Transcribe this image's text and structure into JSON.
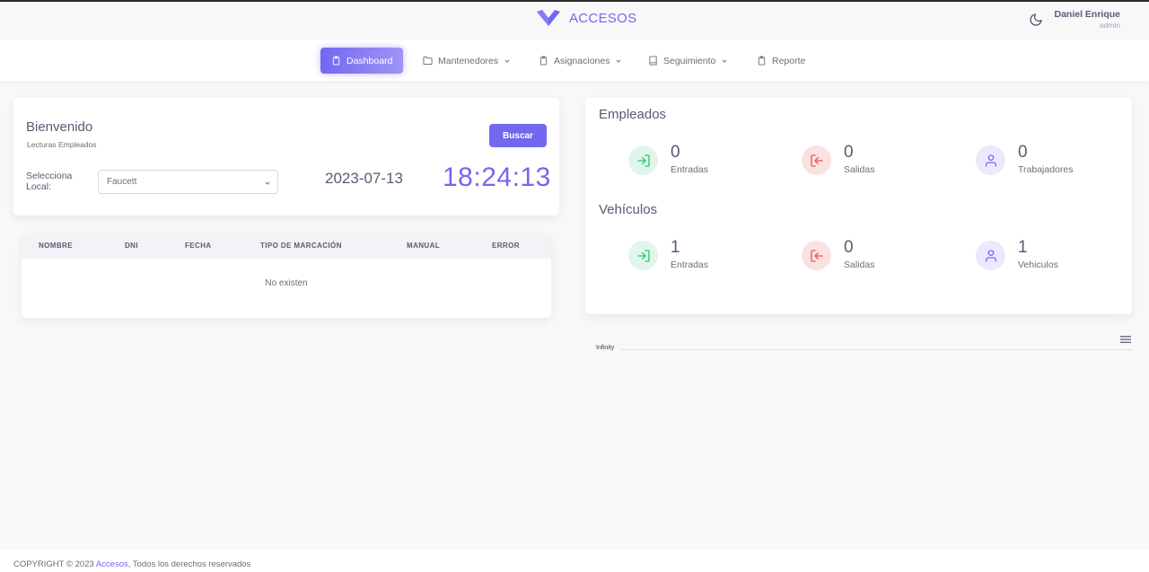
{
  "header": {
    "brand_name": "ACCESOS",
    "user_name": "Daniel Enrique",
    "user_role": "admin",
    "icons": {
      "logo": "brand-v-logo",
      "theme": "moon-icon"
    }
  },
  "nav": {
    "items": [
      {
        "label": "Dashboard",
        "icon": "clipboard-icon",
        "active": true,
        "dropdown": false
      },
      {
        "label": "Mantenedores",
        "icon": "folder-icon",
        "active": false,
        "dropdown": true
      },
      {
        "label": "Asignaciones",
        "icon": "clipboard-icon",
        "active": false,
        "dropdown": true
      },
      {
        "label": "Seguimiento",
        "icon": "book-icon",
        "active": false,
        "dropdown": true
      },
      {
        "label": "Reporte",
        "icon": "clipboard-icon",
        "active": false,
        "dropdown": false
      }
    ]
  },
  "welcome": {
    "title": "Bienvenido",
    "subtitle": "Lecturas Empleados",
    "search_button": "Buscar",
    "local_label": "Selecciona Local:",
    "local_value": "Faucett",
    "date": "2023-07-13",
    "time": "18:24:13"
  },
  "table": {
    "columns": [
      "NOMBRE",
      "DNI",
      "FECHA",
      "TIPO DE MARCACIÓN",
      "MANUAL",
      "ERROR"
    ],
    "empty_message": "No existen"
  },
  "empleados": {
    "title": "Empleados",
    "stats": [
      {
        "value": "0",
        "label": "Entradas",
        "icon": "login-icon"
      },
      {
        "value": "0",
        "label": "Salidas",
        "icon": "logout-icon"
      },
      {
        "value": "0",
        "label": "Trabajadores",
        "icon": "user-icon"
      }
    ]
  },
  "vehiculos": {
    "title": "Vehículos",
    "stats": [
      {
        "value": "1",
        "label": "Entradas",
        "icon": "login-icon"
      },
      {
        "value": "0",
        "label": "Salidas",
        "icon": "logout-icon"
      },
      {
        "value": "1",
        "label": "Vehiculos",
        "icon": "user-icon"
      }
    ]
  },
  "chart": {
    "y_label": "Infinity",
    "menu_icon": "hamburger-icon"
  },
  "footer": {
    "prefix": "COPYRIGHT © 2023",
    "link": "Accesos",
    "suffix": ", Todos los derechos reservados"
  },
  "colors": {
    "primary": "#7367f0",
    "success": "#28c76f",
    "danger": "#ea5455"
  }
}
